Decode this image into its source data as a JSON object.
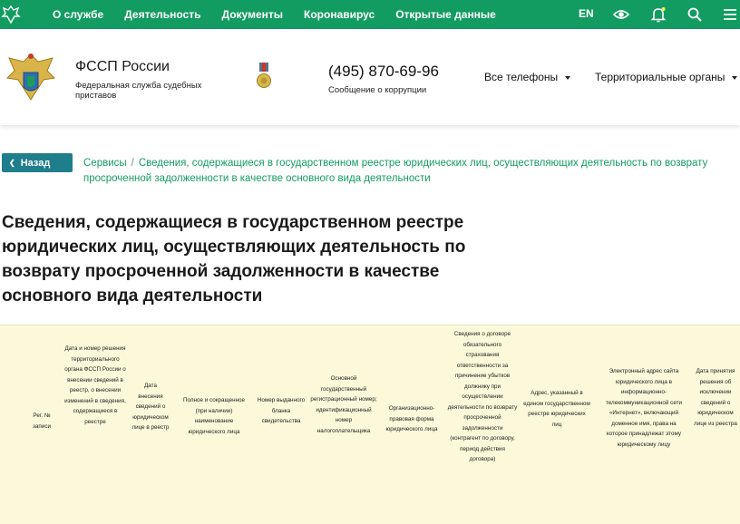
{
  "colors": {
    "nav_green": "#139c62",
    "back_button": "#1f7e8c",
    "table_bg": "#fbf9d9"
  },
  "topnav": {
    "links": [
      "О службе",
      "Деятельность",
      "Документы",
      "Коронавирус",
      "Открытые данные"
    ],
    "lang": "EN",
    "icons": [
      "eye-icon",
      "bell-icon",
      "search-icon",
      "menu-icon"
    ]
  },
  "header": {
    "org_name": "ФССП России",
    "org_full": "Федеральная служба судебных приставов",
    "phone": "(495) 870-69-96",
    "phone_caption": "Сообщение о коррупции",
    "dropdown_phones": "Все телефоны",
    "dropdown_territorial": "Территориальные органы"
  },
  "back_label": "Назад",
  "breadcrumb": {
    "root": "Сервисы",
    "separator": "/",
    "current": "Сведения, содержащиеся в государственном реестре юридических лиц, осуществляющих деятельность по возврату просроченной задолженности в качестве основного вида деятельности"
  },
  "page_title": "Сведения, содержащиеся в государственном реестре юридических лиц, осуществляющих деятельность по возврату просроченной задолженности в качестве основного вида деятельности",
  "table": {
    "columns": [
      "Рег. № записи",
      "Дата и номер решения территориального органа ФССП России о внесении сведений в реестр, о внесении изменений в сведения, содержащиеся в реестре",
      "Дата внесения сведений о юридическом лице в реестр",
      "Полное и сокращенное (при наличии) наименование юридического лица",
      "Номер выданного бланка свидетельства",
      "Основной государственный регистрационный номер; идентификационный номер налогоплательщика",
      "Организационно-правовая форма юридического лица",
      "Сведения о договоре обязательного страхования ответственности за причинение убытков должнику при осуществлении деятельности по возврату просроченной задолженности (контрагент по договору, период действия договора)",
      "Адрес, указанный в едином государственном реестре юридических лиц",
      "Электронный адрес сайта юридического лица в информационно-телекоммуникационной сети «Интернет», включающий доменное имя, права на которое принадлежат этому юридическому лицу",
      "Дата принятия решения об исключении сведений о юридическом лице из реестра"
    ]
  }
}
